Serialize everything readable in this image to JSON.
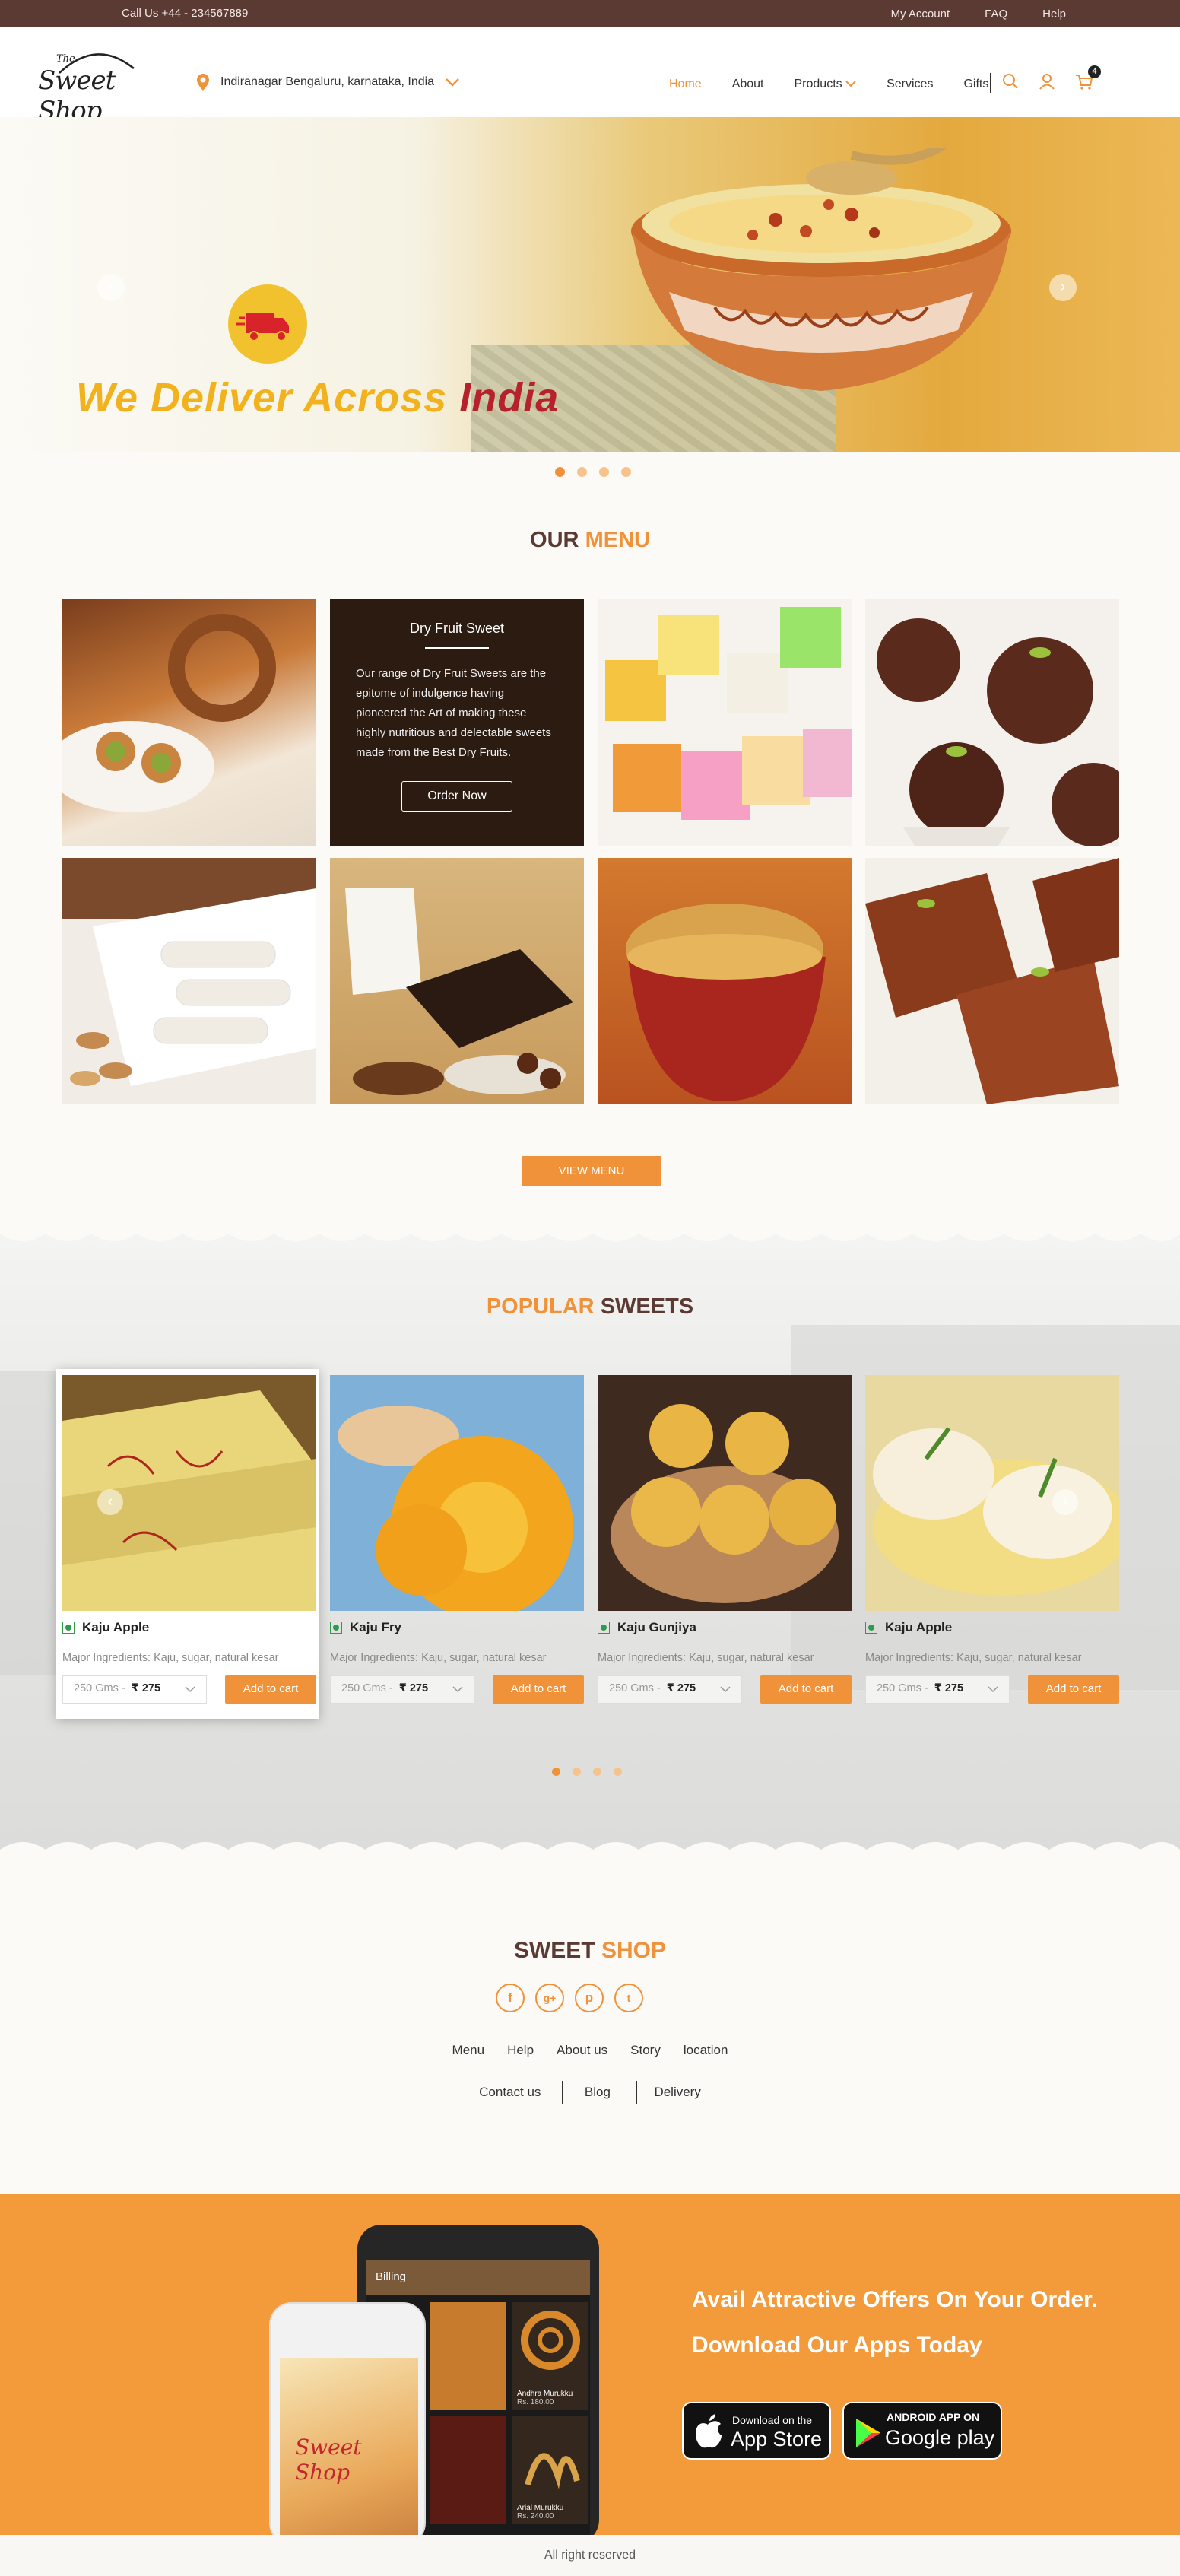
{
  "topbar": {
    "call": "Call Us +44 - 234567889",
    "links": [
      "My Account",
      "FAQ",
      "Help"
    ]
  },
  "header": {
    "logo_the": "The",
    "logo_name": "Sweet Shop",
    "location": "Indiranagar Bengaluru, karnataka, India",
    "nav": [
      "Home",
      "About",
      "Products",
      "Services",
      "Gifts"
    ],
    "cart_count": "4"
  },
  "hero": {
    "tagline_part1": "We Deliver Across",
    "tagline_part2": "India",
    "slides": 4,
    "active_slide": 0
  },
  "menu": {
    "title_part1": "OUR",
    "title_part2": "MENU",
    "overlay": {
      "title": "Dry Fruit Sweet",
      "description": "Our range of Dry Fruit Sweets are the epitome of indulgence having pioneered the Art of making these highly nutritious and delectable sweets made from the Best Dry Fruits.",
      "button": "Order Now"
    },
    "view_button": "VIEW MENU"
  },
  "popular": {
    "title_part1": "POPULAR",
    "title_part2": "SWEETS",
    "items": [
      {
        "name": "Kaju Apple",
        "ingredients": "Major Ingredients: Kaju, sugar, natural kesar",
        "weight": "250 Gms -",
        "price": "₹ 275",
        "button": "Add to cart"
      },
      {
        "name": "Kaju Fry",
        "ingredients": "Major Ingredients: Kaju, sugar, natural kesar",
        "weight": "250 Gms -",
        "price": "₹ 275",
        "button": "Add to cart"
      },
      {
        "name": "Kaju Gunjiya",
        "ingredients": "Major Ingredients: Kaju, sugar, natural kesar",
        "weight": "250 Gms -",
        "price": "₹ 275",
        "button": "Add to cart"
      },
      {
        "name": "Kaju Apple",
        "ingredients": "Major Ingredients: Kaju, sugar, natural kesar",
        "weight": "250 Gms -",
        "price": "₹ 275",
        "button": "Add to cart"
      }
    ],
    "slides": 4,
    "active_slide": 0
  },
  "footer": {
    "title_part1": "SWEET",
    "title_part2": "SHOP",
    "links_row1": [
      "Menu",
      "Help",
      "About us",
      "Story",
      "location"
    ],
    "links_row2": [
      "Contact us",
      "Blog",
      "Delivery"
    ]
  },
  "app_promo": {
    "line1": "Avail Attractive Offers On Your Order.",
    "line2": "Download Our Apps Today",
    "phone_header": "Billing",
    "phone_item1": "Andhra Murukku",
    "phone_item1_price": "Rs. 180.00",
    "phone_item2": "Arial Murukku",
    "phone_item2_price": "Rs. 240.00",
    "appstore_small": "Download on the",
    "appstore_big": "App Store",
    "play_small": "ANDROID APP ON",
    "play_big": "Google play",
    "screen_logo": "Sweet Shop"
  },
  "copyright": "All right reserved",
  "colors": {
    "accent": "#f0923a",
    "brown": "#5b3a33",
    "topbar": "#5b3a33",
    "app_bg": "#f39a3a"
  }
}
